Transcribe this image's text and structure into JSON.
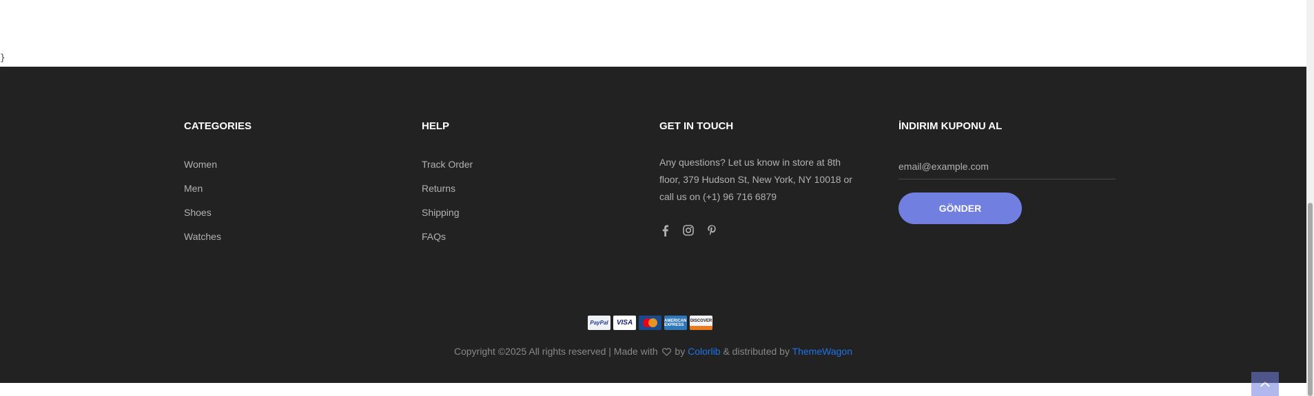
{
  "stray_brace": "}",
  "columns": {
    "categories": {
      "title": "CATEGORIES",
      "items": [
        "Women",
        "Men",
        "Shoes",
        "Watches"
      ]
    },
    "help": {
      "title": "HELP",
      "items": [
        "Track Order",
        "Returns",
        "Shipping",
        "FAQs"
      ]
    },
    "contact": {
      "title": "GET IN TOUCH",
      "text": "Any questions? Let us know in store at 8th floor, 379 Hudson St, New York, NY 10018 or call us on (+1) 96 716 6879",
      "socials": [
        "facebook-icon",
        "instagram-icon",
        "pinterest-icon"
      ]
    },
    "newsletter": {
      "title": "İNDIRIM KUPONU AL",
      "email_placeholder": "email@example.com",
      "button_label": "GÖNDER"
    }
  },
  "payments": {
    "paypal": "PayPal",
    "visa": "VISA",
    "amex": "AMERICAN EXPRESS",
    "discover": "DISCOVER"
  },
  "copyright": {
    "prefix": "Copyright ©2025 All rights reserved | Made with",
    "by": "by",
    "colorlib": "Colorlib",
    "distributed": "& distributed by",
    "themewagon": "ThemeWagon"
  },
  "colors": {
    "footer_bg": "#222222",
    "accent": "#717fe0",
    "link": "#1e73e8",
    "muted_text": "#b2b2b2"
  }
}
